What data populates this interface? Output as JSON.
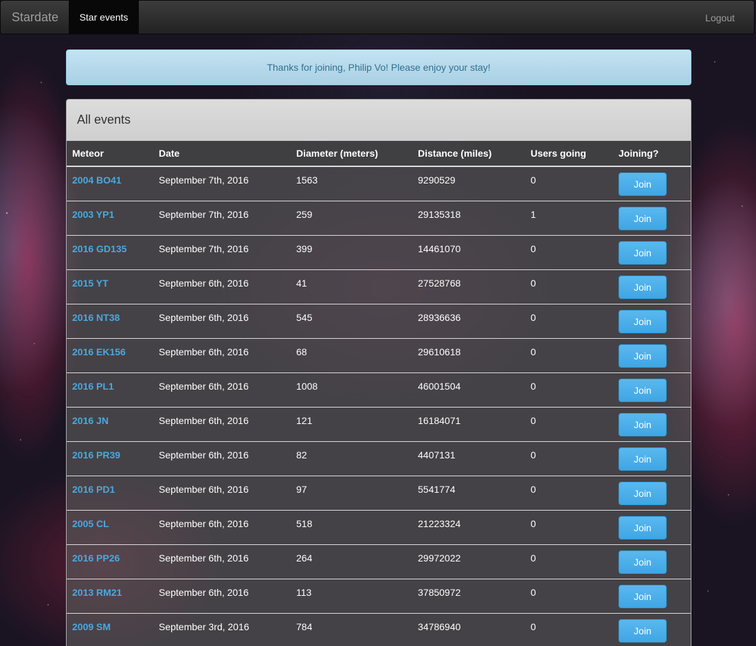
{
  "navbar": {
    "brand": "Stardate",
    "active_tab": "Star events",
    "logout": "Logout"
  },
  "alert": {
    "message": "Thanks for joining, Philip Vo! Please enjoy your stay!"
  },
  "panel": {
    "title": "All events",
    "columns": [
      "Meteor",
      "Date",
      "Diameter (meters)",
      "Distance (miles)",
      "Users going",
      "Joining?"
    ],
    "join_label": "Join",
    "rows": [
      {
        "meteor": "2004 BO41",
        "date": "September 7th, 2016",
        "diameter": "1563",
        "distance": "9290529",
        "users": "0"
      },
      {
        "meteor": "2003 YP1",
        "date": "September 7th, 2016",
        "diameter": "259",
        "distance": "29135318",
        "users": "1"
      },
      {
        "meteor": "2016 GD135",
        "date": "September 7th, 2016",
        "diameter": "399",
        "distance": "14461070",
        "users": "0"
      },
      {
        "meteor": "2015 YT",
        "date": "September 6th, 2016",
        "diameter": "41",
        "distance": "27528768",
        "users": "0"
      },
      {
        "meteor": "2016 NT38",
        "date": "September 6th, 2016",
        "diameter": "545",
        "distance": "28936636",
        "users": "0"
      },
      {
        "meteor": "2016 EK156",
        "date": "September 6th, 2016",
        "diameter": "68",
        "distance": "29610618",
        "users": "0"
      },
      {
        "meteor": "2016 PL1",
        "date": "September 6th, 2016",
        "diameter": "1008",
        "distance": "46001504",
        "users": "0"
      },
      {
        "meteor": "2016 JN",
        "date": "September 6th, 2016",
        "diameter": "121",
        "distance": "16184071",
        "users": "0"
      },
      {
        "meteor": "2016 PR39",
        "date": "September 6th, 2016",
        "diameter": "82",
        "distance": "4407131",
        "users": "0"
      },
      {
        "meteor": "2016 PD1",
        "date": "September 6th, 2016",
        "diameter": "97",
        "distance": "5541774",
        "users": "0"
      },
      {
        "meteor": "2005 CL",
        "date": "September 6th, 2016",
        "diameter": "518",
        "distance": "21223324",
        "users": "0"
      },
      {
        "meteor": "2016 PP26",
        "date": "September 6th, 2016",
        "diameter": "264",
        "distance": "29972022",
        "users": "0"
      },
      {
        "meteor": "2013 RM21",
        "date": "September 6th, 2016",
        "diameter": "113",
        "distance": "37850972",
        "users": "0"
      },
      {
        "meteor": "2009 SM",
        "date": "September 3rd, 2016",
        "diameter": "784",
        "distance": "34786940",
        "users": "0"
      }
    ]
  }
}
